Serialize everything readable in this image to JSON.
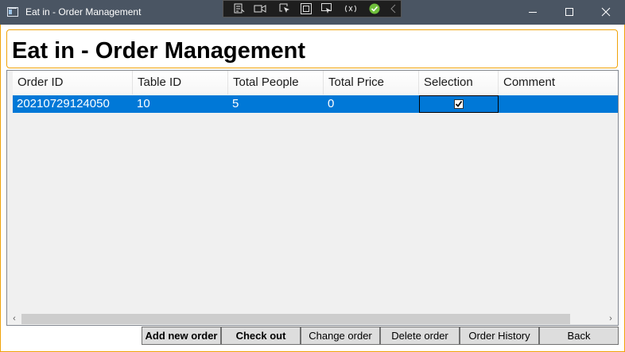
{
  "window": {
    "title": "Eat in - Order Management",
    "accent_color": "#f0a30a",
    "titlebar_color": "#4a5563"
  },
  "debug_toolbar": {
    "icons": [
      "live-visual-tree-icon",
      "record-icon",
      "select-element-icon",
      "display-layout-adorners-icon",
      "track-focus-icon",
      "hot-reload-icon",
      "checkmark-icon",
      "collapse-chevron-icon"
    ]
  },
  "page": {
    "title": "Eat in - Order Management"
  },
  "grid": {
    "columns": [
      "Order ID",
      "Table ID",
      "Total People",
      "Total Price",
      "Selection",
      "Comment"
    ],
    "rows": [
      {
        "order_id": "20210729124050",
        "table_id": "10",
        "total_people": "5",
        "total_price": "0",
        "selection": true,
        "comment": ""
      }
    ],
    "selected_row_color": "#0078d7"
  },
  "buttons": {
    "add_new_order": "Add new order",
    "check_out": "Check out",
    "change_order": "Change order",
    "delete_order": "Delete order",
    "order_history": "Order History",
    "back": "Back"
  }
}
